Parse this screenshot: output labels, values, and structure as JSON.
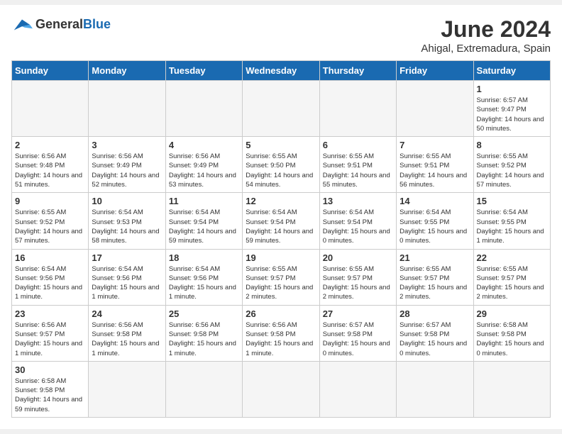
{
  "header": {
    "logo_general": "General",
    "logo_blue": "Blue",
    "title": "June 2024",
    "location": "Ahigal, Extremadura, Spain"
  },
  "weekdays": [
    "Sunday",
    "Monday",
    "Tuesday",
    "Wednesday",
    "Thursday",
    "Friday",
    "Saturday"
  ],
  "weeks": [
    [
      {
        "day": "",
        "info": ""
      },
      {
        "day": "",
        "info": ""
      },
      {
        "day": "",
        "info": ""
      },
      {
        "day": "",
        "info": ""
      },
      {
        "day": "",
        "info": ""
      },
      {
        "day": "",
        "info": ""
      },
      {
        "day": "1",
        "info": "Sunrise: 6:57 AM\nSunset: 9:47 PM\nDaylight: 14 hours\nand 50 minutes."
      }
    ],
    [
      {
        "day": "2",
        "info": "Sunrise: 6:56 AM\nSunset: 9:48 PM\nDaylight: 14 hours\nand 51 minutes."
      },
      {
        "day": "3",
        "info": "Sunrise: 6:56 AM\nSunset: 9:49 PM\nDaylight: 14 hours\nand 52 minutes."
      },
      {
        "day": "4",
        "info": "Sunrise: 6:56 AM\nSunset: 9:49 PM\nDaylight: 14 hours\nand 53 minutes."
      },
      {
        "day": "5",
        "info": "Sunrise: 6:55 AM\nSunset: 9:50 PM\nDaylight: 14 hours\nand 54 minutes."
      },
      {
        "day": "6",
        "info": "Sunrise: 6:55 AM\nSunset: 9:51 PM\nDaylight: 14 hours\nand 55 minutes."
      },
      {
        "day": "7",
        "info": "Sunrise: 6:55 AM\nSunset: 9:51 PM\nDaylight: 14 hours\nand 56 minutes."
      },
      {
        "day": "8",
        "info": "Sunrise: 6:55 AM\nSunset: 9:52 PM\nDaylight: 14 hours\nand 57 minutes."
      }
    ],
    [
      {
        "day": "9",
        "info": "Sunrise: 6:55 AM\nSunset: 9:52 PM\nDaylight: 14 hours\nand 57 minutes."
      },
      {
        "day": "10",
        "info": "Sunrise: 6:54 AM\nSunset: 9:53 PM\nDaylight: 14 hours\nand 58 minutes."
      },
      {
        "day": "11",
        "info": "Sunrise: 6:54 AM\nSunset: 9:54 PM\nDaylight: 14 hours\nand 59 minutes."
      },
      {
        "day": "12",
        "info": "Sunrise: 6:54 AM\nSunset: 9:54 PM\nDaylight: 14 hours\nand 59 minutes."
      },
      {
        "day": "13",
        "info": "Sunrise: 6:54 AM\nSunset: 9:54 PM\nDaylight: 15 hours\nand 0 minutes."
      },
      {
        "day": "14",
        "info": "Sunrise: 6:54 AM\nSunset: 9:55 PM\nDaylight: 15 hours\nand 0 minutes."
      },
      {
        "day": "15",
        "info": "Sunrise: 6:54 AM\nSunset: 9:55 PM\nDaylight: 15 hours\nand 1 minute."
      }
    ],
    [
      {
        "day": "16",
        "info": "Sunrise: 6:54 AM\nSunset: 9:56 PM\nDaylight: 15 hours\nand 1 minute."
      },
      {
        "day": "17",
        "info": "Sunrise: 6:54 AM\nSunset: 9:56 PM\nDaylight: 15 hours\nand 1 minute."
      },
      {
        "day": "18",
        "info": "Sunrise: 6:54 AM\nSunset: 9:56 PM\nDaylight: 15 hours\nand 1 minute."
      },
      {
        "day": "19",
        "info": "Sunrise: 6:55 AM\nSunset: 9:57 PM\nDaylight: 15 hours\nand 2 minutes."
      },
      {
        "day": "20",
        "info": "Sunrise: 6:55 AM\nSunset: 9:57 PM\nDaylight: 15 hours\nand 2 minutes."
      },
      {
        "day": "21",
        "info": "Sunrise: 6:55 AM\nSunset: 9:57 PM\nDaylight: 15 hours\nand 2 minutes."
      },
      {
        "day": "22",
        "info": "Sunrise: 6:55 AM\nSunset: 9:57 PM\nDaylight: 15 hours\nand 2 minutes."
      }
    ],
    [
      {
        "day": "23",
        "info": "Sunrise: 6:56 AM\nSunset: 9:57 PM\nDaylight: 15 hours\nand 1 minute."
      },
      {
        "day": "24",
        "info": "Sunrise: 6:56 AM\nSunset: 9:58 PM\nDaylight: 15 hours\nand 1 minute."
      },
      {
        "day": "25",
        "info": "Sunrise: 6:56 AM\nSunset: 9:58 PM\nDaylight: 15 hours\nand 1 minute."
      },
      {
        "day": "26",
        "info": "Sunrise: 6:56 AM\nSunset: 9:58 PM\nDaylight: 15 hours\nand 1 minute."
      },
      {
        "day": "27",
        "info": "Sunrise: 6:57 AM\nSunset: 9:58 PM\nDaylight: 15 hours\nand 0 minutes."
      },
      {
        "day": "28",
        "info": "Sunrise: 6:57 AM\nSunset: 9:58 PM\nDaylight: 15 hours\nand 0 minutes."
      },
      {
        "day": "29",
        "info": "Sunrise: 6:58 AM\nSunset: 9:58 PM\nDaylight: 15 hours\nand 0 minutes."
      }
    ],
    [
      {
        "day": "30",
        "info": "Sunrise: 6:58 AM\nSunset: 9:58 PM\nDaylight: 14 hours\nand 59 minutes."
      },
      {
        "day": "",
        "info": ""
      },
      {
        "day": "",
        "info": ""
      },
      {
        "day": "",
        "info": ""
      },
      {
        "day": "",
        "info": ""
      },
      {
        "day": "",
        "info": ""
      },
      {
        "day": "",
        "info": ""
      }
    ]
  ]
}
